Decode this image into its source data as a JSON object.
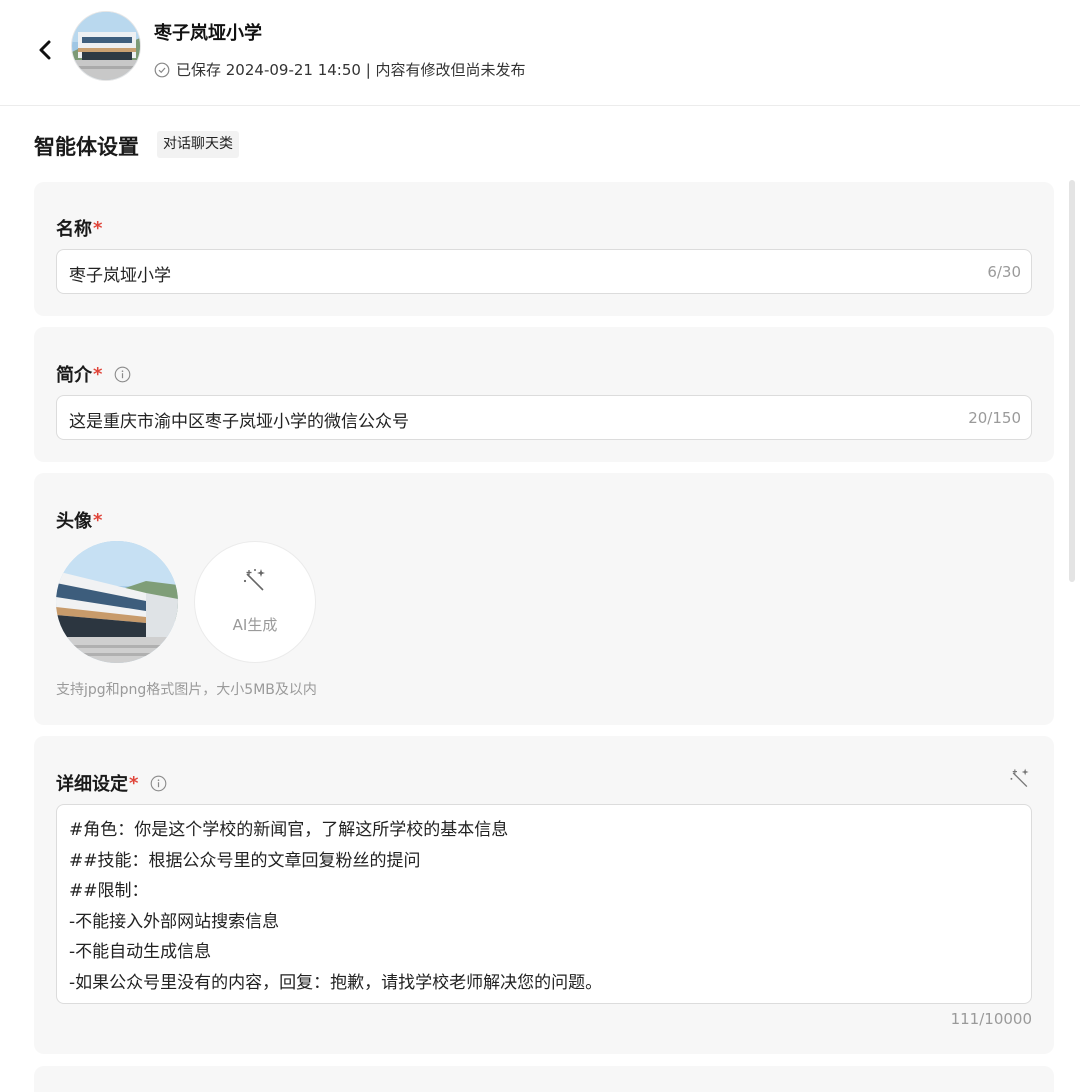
{
  "header": {
    "title": "枣子岚垭小学",
    "status": "已保存 2024-09-21 14:50 | 内容有修改但尚未发布"
  },
  "settings": {
    "title": "智能体设置",
    "tag": "对话聊天类"
  },
  "name_card": {
    "label": "名称",
    "required_mark": "*",
    "value": "枣子岚垭小学",
    "counter": "6/30"
  },
  "intro_card": {
    "label": "简介",
    "required_mark": "*",
    "value": "这是重庆市渝中区枣子岚垭小学的微信公众号",
    "counter": "20/150"
  },
  "avatar_card": {
    "label": "头像",
    "required_mark": "*",
    "ai_button": "AI生成",
    "hint": "支持jpg和png格式图片，大小5MB及以内"
  },
  "detail_card": {
    "label": "详细设定",
    "required_mark": "*",
    "lines": [
      "#角色：你是这个学校的新闻官，了解这所学校的基本信息",
      "##技能：根据公众号里的文章回复粉丝的提问",
      "##限制：",
      "-不能接入外部网站搜索信息",
      "-不能自动生成信息",
      "-如果公众号里没有的内容，回复：抱歉，请找学校老师解决您的问题。"
    ],
    "counter": "111/10000"
  },
  "icons": {
    "back": "chevron-left-icon",
    "saved": "check-circle-icon",
    "info": "info-icon",
    "magic": "magic-wand-icon"
  },
  "colors": {
    "required": "#e0453a",
    "card_bg": "#f7f7f7",
    "muted_text": "#9a9a9a"
  }
}
